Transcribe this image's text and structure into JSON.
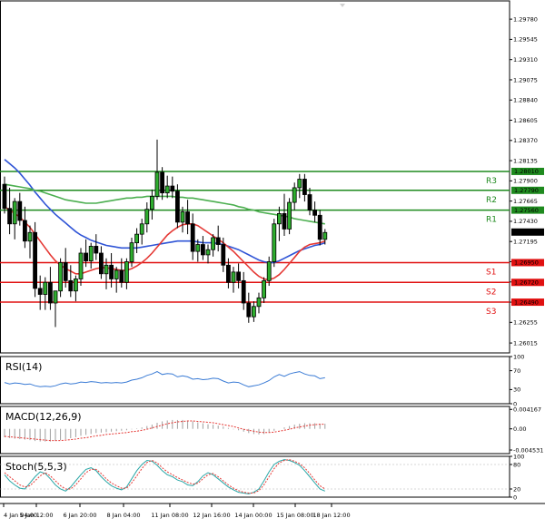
{
  "chart_data": {
    "type": "candlestick",
    "price_axis": {
      "range": [
        1.259,
        1.2995
      ],
      "ticks": [
        "1.29780",
        "1.29545",
        "1.29310",
        "1.29075",
        "1.28840",
        "1.28605",
        "1.28370",
        "1.28135",
        "1.27900",
        "1.27665",
        "1.27430",
        "1.27195",
        "1.26960",
        "1.26725",
        "1.26490",
        "1.26255",
        "1.26015"
      ]
    },
    "time_axis": {
      "labels": [
        "4 Jan 04:00",
        "5 Jan 12:00",
        "6 Jan 20:00",
        "8 Jan 04:00",
        "11 Jan 08:00",
        "12 Jan 16:00",
        "14 Jan 00:00",
        "15 Jan 08:00",
        "18 Jan 12:00"
      ]
    },
    "candles": [
      [
        1.2786,
        1.2795,
        1.2752,
        1.2758
      ],
      [
        1.2758,
        1.2782,
        1.2728,
        1.274
      ],
      [
        1.274,
        1.277,
        1.2722,
        1.2766
      ],
      [
        1.2766,
        1.2776,
        1.2738,
        1.2744
      ],
      [
        1.2744,
        1.276,
        1.2712,
        1.272
      ],
      [
        1.272,
        1.2738,
        1.27,
        1.273
      ],
      [
        1.273,
        1.2742,
        1.2655,
        1.2665
      ],
      [
        1.2665,
        1.268,
        1.264,
        1.2658
      ],
      [
        1.2658,
        1.2678,
        1.264,
        1.2672
      ],
      [
        1.2672,
        1.269,
        1.264,
        1.2648
      ],
      [
        1.2648,
        1.266,
        1.262,
        1.2662
      ],
      [
        1.2662,
        1.27,
        1.2655,
        1.2695
      ],
      [
        1.2695,
        1.2712,
        1.2666,
        1.2674
      ],
      [
        1.2674,
        1.2692,
        1.2655,
        1.2662
      ],
      [
        1.2662,
        1.268,
        1.265,
        1.2676
      ],
      [
        1.2676,
        1.2712,
        1.2668,
        1.2706
      ],
      [
        1.2706,
        1.2722,
        1.269,
        1.2697
      ],
      [
        1.2697,
        1.2718,
        1.2688,
        1.2714
      ],
      [
        1.2714,
        1.2728,
        1.2698,
        1.2706
      ],
      [
        1.2706,
        1.2714,
        1.2676,
        1.2682
      ],
      [
        1.2682,
        1.27,
        1.2664,
        1.2692
      ],
      [
        1.2692,
        1.2706,
        1.2666,
        1.2676
      ],
      [
        1.2676,
        1.269,
        1.266,
        1.2686
      ],
      [
        1.2686,
        1.27,
        1.2666,
        1.2672
      ],
      [
        1.2672,
        1.27,
        1.2664,
        1.2696
      ],
      [
        1.2696,
        1.2724,
        1.269,
        1.2718
      ],
      [
        1.2718,
        1.2735,
        1.2706,
        1.2728
      ],
      [
        1.2728,
        1.2746,
        1.2716,
        1.274
      ],
      [
        1.274,
        1.2765,
        1.273,
        1.2757
      ],
      [
        1.2757,
        1.278,
        1.2745,
        1.2772
      ],
      [
        1.2772,
        1.2838,
        1.2768,
        1.28
      ],
      [
        1.28,
        1.2806,
        1.2768,
        1.2776
      ],
      [
        1.2776,
        1.2796,
        1.277,
        1.2784
      ],
      [
        1.2784,
        1.2795,
        1.277,
        1.2778
      ],
      [
        1.2778,
        1.2786,
        1.2735,
        1.2742
      ],
      [
        1.2742,
        1.276,
        1.273,
        1.2754
      ],
      [
        1.2754,
        1.2768,
        1.2728,
        1.274
      ],
      [
        1.274,
        1.2752,
        1.2698,
        1.2708
      ],
      [
        1.2708,
        1.2722,
        1.2696,
        1.2716
      ],
      [
        1.2716,
        1.2726,
        1.2698,
        1.2704
      ],
      [
        1.2704,
        1.2716,
        1.2694,
        1.271
      ],
      [
        1.271,
        1.2728,
        1.2702,
        1.2724
      ],
      [
        1.2724,
        1.2738,
        1.2708,
        1.2716
      ],
      [
        1.2716,
        1.2724,
        1.2684,
        1.2692
      ],
      [
        1.2692,
        1.27,
        1.2665,
        1.2672
      ],
      [
        1.2672,
        1.269,
        1.266,
        1.2684
      ],
      [
        1.2684,
        1.2694,
        1.2665,
        1.2674
      ],
      [
        1.2674,
        1.2684,
        1.264,
        1.2648
      ],
      [
        1.2648,
        1.266,
        1.2625,
        1.2632
      ],
      [
        1.2632,
        1.265,
        1.2626,
        1.2644
      ],
      [
        1.2644,
        1.266,
        1.2636,
        1.2654
      ],
      [
        1.2654,
        1.2678,
        1.2648,
        1.2674
      ],
      [
        1.2674,
        1.2702,
        1.2668,
        1.2696
      ],
      [
        1.2696,
        1.2746,
        1.269,
        1.274
      ],
      [
        1.274,
        1.276,
        1.272,
        1.2752
      ],
      [
        1.2752,
        1.2775,
        1.2726,
        1.2734
      ],
      [
        1.2734,
        1.277,
        1.2728,
        1.2765
      ],
      [
        1.2765,
        1.2788,
        1.2756,
        1.2782
      ],
      [
        1.2782,
        1.2798,
        1.277,
        1.2792
      ],
      [
        1.2792,
        1.2798,
        1.2766,
        1.2774
      ],
      [
        1.2774,
        1.2782,
        1.275,
        1.2756
      ],
      [
        1.2756,
        1.2766,
        1.2742,
        1.275
      ],
      [
        1.275,
        1.2756,
        1.2715,
        1.2722
      ],
      [
        1.2722,
        1.2734,
        1.2716,
        1.273
      ]
    ],
    "moving_averages": [
      {
        "color": "#2f54d6",
        "values": [
          1.2815,
          1.281,
          1.2805,
          1.2799,
          1.2792,
          1.2785,
          1.2777,
          1.277,
          1.2763,
          1.2757,
          1.2751,
          1.2746,
          1.2741,
          1.2736,
          1.2731,
          1.2727,
          1.2724,
          1.2721,
          1.2719,
          1.2717,
          1.2715,
          1.2714,
          1.2713,
          1.2712,
          1.2712,
          1.2712,
          1.2712,
          1.2713,
          1.2714,
          1.2715,
          1.2716,
          1.2717,
          1.2718,
          1.2719,
          1.272,
          1.272,
          1.272,
          1.272,
          1.2719,
          1.2718,
          1.2718,
          1.2718,
          1.2717,
          1.2716,
          1.2714,
          1.2712,
          1.271,
          1.2707,
          1.2704,
          1.2701,
          1.2698,
          1.2696,
          1.2695,
          1.2695,
          1.2697,
          1.27,
          1.2703,
          1.2706,
          1.2709,
          1.2711,
          1.2713,
          1.2715,
          1.2716,
          1.2718
        ]
      },
      {
        "color": "#4caf50",
        "values": [
          1.2786,
          1.2785,
          1.2784,
          1.2783,
          1.2782,
          1.2781,
          1.2779,
          1.2778,
          1.2776,
          1.2774,
          1.2772,
          1.277,
          1.2768,
          1.2767,
          1.2766,
          1.2765,
          1.2764,
          1.2764,
          1.2764,
          1.2765,
          1.2766,
          1.2767,
          1.2768,
          1.2769,
          1.277,
          1.277,
          1.2771,
          1.2771,
          1.2772,
          1.2772,
          1.2772,
          1.2772,
          1.2772,
          1.2772,
          1.2771,
          1.2771,
          1.277,
          1.277,
          1.2769,
          1.2768,
          1.2767,
          1.2766,
          1.2765,
          1.2764,
          1.2763,
          1.2762,
          1.276,
          1.2759,
          1.2757,
          1.2756,
          1.2754,
          1.2753,
          1.2752,
          1.2751,
          1.275,
          1.2749,
          1.2748,
          1.2746,
          1.2745,
          1.2744,
          1.2743,
          1.2742,
          1.2741,
          1.274
        ]
      },
      {
        "color": "#e53935",
        "values": [
          1.276,
          1.2756,
          1.2752,
          1.2748,
          1.2742,
          1.2736,
          1.2728,
          1.272,
          1.2712,
          1.2704,
          1.2697,
          1.2692,
          1.2688,
          1.2685,
          1.2682,
          1.2682,
          1.2684,
          1.2686,
          1.2688,
          1.2689,
          1.2689,
          1.2688,
          1.2687,
          1.2686,
          1.2686,
          1.2688,
          1.2691,
          1.2695,
          1.27,
          1.2706,
          1.2713,
          1.272,
          1.2727,
          1.2732,
          1.2736,
          1.2739,
          1.274,
          1.274,
          1.2738,
          1.2734,
          1.273,
          1.2726,
          1.2722,
          1.2718,
          1.2713,
          1.2708,
          1.2702,
          1.2696,
          1.269,
          1.2684,
          1.2679,
          1.2676,
          1.2675,
          1.2677,
          1.2681,
          1.2687,
          1.2694,
          1.2701,
          1.2708,
          1.2713,
          1.2716,
          1.2717,
          1.2718,
          1.272
        ]
      }
    ],
    "current_price": {
      "value": 1.27305,
      "label": "1.27305"
    },
    "levels": [
      {
        "name": "R3",
        "value": 1.2801,
        "label": "1.28010",
        "color": "#1e8a1e"
      },
      {
        "name": "R2",
        "value": 1.2779,
        "label": "1.27790",
        "color": "#1e8a1e"
      },
      {
        "name": "R1",
        "value": 1.2756,
        "label": "1.27560",
        "color": "#1e8a1e"
      },
      {
        "name": "S1",
        "value": 1.2695,
        "label": "1.26950",
        "color": "#e01010"
      },
      {
        "name": "S2",
        "value": 1.2672,
        "label": "1.26720",
        "color": "#e01010"
      },
      {
        "name": "S3",
        "value": 1.2649,
        "label": "1.26490",
        "color": "#e01010"
      }
    ],
    "indicators": [
      {
        "id": "rsi",
        "title": "RSI(14)",
        "range": [
          0,
          100
        ],
        "ticks": [
          {
            "v": 100,
            "label": "100"
          },
          {
            "v": 70,
            "label": "70"
          },
          {
            "v": 30,
            "label": "30"
          },
          {
            "v": 0,
            "label": "0"
          }
        ],
        "color": "#3a7bd5",
        "values": [
          45,
          42,
          44,
          43,
          41,
          42,
          38,
          36,
          37,
          36,
          38,
          42,
          44,
          42,
          43,
          46,
          45,
          47,
          46,
          44,
          45,
          44,
          45,
          44,
          46,
          50,
          52,
          55,
          60,
          63,
          68,
          62,
          64,
          63,
          57,
          59,
          57,
          52,
          53,
          51,
          52,
          54,
          53,
          48,
          44,
          46,
          45,
          40,
          36,
          38,
          40,
          44,
          49,
          57,
          62,
          58,
          63,
          66,
          68,
          63,
          60,
          59,
          53,
          55
        ]
      },
      {
        "id": "macd",
        "title": "MACD(12,26,9)",
        "range": [
          -0.0053,
          0.0048
        ],
        "ticks": [
          {
            "v": 0.004167,
            "label": "0.004167"
          },
          {
            "v": 0.0,
            "label": "0.00"
          },
          {
            "v": -0.004531,
            "label": "-0.004531"
          }
        ],
        "hist_color": "#9e9e9e",
        "signal_color": "#e53935",
        "hist": [
          -0.0018,
          -0.002,
          -0.0021,
          -0.0022,
          -0.0023,
          -0.0024,
          -0.0026,
          -0.0027,
          -0.0027,
          -0.0027,
          -0.0026,
          -0.0024,
          -0.0022,
          -0.002,
          -0.0018,
          -0.0015,
          -0.0013,
          -0.0011,
          -0.0009,
          -0.0008,
          -0.0007,
          -0.0006,
          -0.0005,
          -0.0004,
          -0.0003,
          -0.0001,
          0.0001,
          0.0003,
          0.0006,
          0.0009,
          0.0013,
          0.0016,
          0.0018,
          0.0019,
          0.0019,
          0.0019,
          0.0018,
          0.0016,
          0.0014,
          0.0012,
          0.001,
          0.0009,
          0.0007,
          0.0005,
          0.0002,
          -0.0001,
          -0.0003,
          -0.0006,
          -0.0009,
          -0.0011,
          -0.0012,
          -0.0011,
          -0.0008,
          -0.0004,
          0.0,
          0.0003,
          0.0006,
          0.0009,
          0.0011,
          0.0012,
          0.0012,
          0.0012,
          0.0011,
          0.0011
        ],
        "signal": [
          -0.0016,
          -0.0017,
          -0.0018,
          -0.0019,
          -0.002,
          -0.0021,
          -0.0022,
          -0.0023,
          -0.0024,
          -0.0025,
          -0.0025,
          -0.0025,
          -0.0024,
          -0.0023,
          -0.0022,
          -0.002,
          -0.0019,
          -0.0017,
          -0.0015,
          -0.0014,
          -0.0012,
          -0.0011,
          -0.001,
          -0.0009,
          -0.0008,
          -0.0006,
          -0.0005,
          -0.0003,
          -0.0001,
          0.0002,
          0.0005,
          0.0008,
          0.0011,
          0.0013,
          0.0015,
          0.0016,
          0.0017,
          0.0017,
          0.0016,
          0.0015,
          0.0014,
          0.0013,
          0.0011,
          0.0009,
          0.0007,
          0.0005,
          0.0002,
          -0.0001,
          -0.0003,
          -0.0005,
          -0.0007,
          -0.0008,
          -0.0008,
          -0.0007,
          -0.0005,
          -0.0003,
          -0.0001,
          0.0002,
          0.0004,
          0.0006,
          0.0008,
          0.0009,
          0.001,
          0.001
        ]
      },
      {
        "id": "stoch",
        "title": "Stoch(5,5,3)",
        "range": [
          0,
          100
        ],
        "ticks": [
          {
            "v": 100,
            "label": "100"
          },
          {
            "v": 80,
            "label": "80"
          },
          {
            "v": 20,
            "label": "20"
          },
          {
            "v": 0,
            "label": "0"
          }
        ],
        "main_color": "#2aa7a7",
        "signal_color": "#e53935",
        "main": [
          55,
          40,
          30,
          22,
          20,
          35,
          50,
          62,
          58,
          45,
          30,
          20,
          15,
          25,
          40,
          55,
          68,
          72,
          65,
          50,
          38,
          28,
          22,
          18,
          25,
          45,
          65,
          80,
          90,
          88,
          78,
          65,
          55,
          50,
          42,
          38,
          30,
          28,
          38,
          52,
          60,
          55,
          45,
          35,
          25,
          18,
          12,
          10,
          8,
          12,
          20,
          40,
          62,
          80,
          88,
          92,
          90,
          85,
          78,
          65,
          50,
          35,
          20,
          15
        ],
        "signal": [
          60,
          50,
          40,
          30,
          25,
          28,
          40,
          52,
          60,
          52,
          40,
          28,
          20,
          20,
          30,
          45,
          60,
          68,
          68,
          58,
          45,
          35,
          28,
          22,
          22,
          35,
          52,
          70,
          85,
          90,
          84,
          72,
          62,
          55,
          48,
          42,
          36,
          32,
          34,
          45,
          55,
          58,
          50,
          40,
          30,
          22,
          16,
          12,
          10,
          10,
          16,
          30,
          50,
          70,
          84,
          90,
          92,
          88,
          82,
          72,
          58,
          42,
          28,
          20
        ]
      }
    ]
  }
}
